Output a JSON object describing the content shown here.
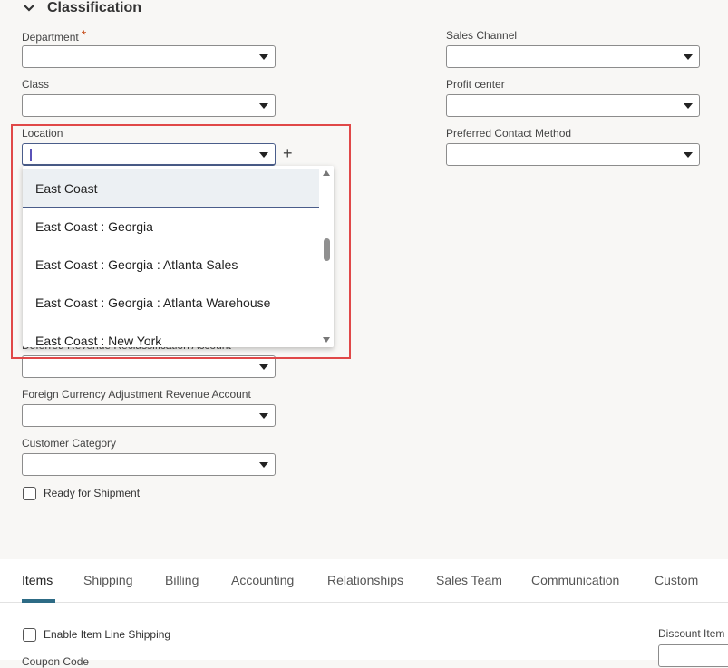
{
  "section": {
    "title": "Classification"
  },
  "left_fields": {
    "department_label": "Department",
    "department_required": "*",
    "class_label": "Class",
    "location_label": "Location",
    "deferred_label": "Deferred Revenue Reclassification Account",
    "foreign_label": "Foreign Currency Adjustment Revenue Account",
    "customer_category_label": "Customer Category",
    "ready_label": "Ready for Shipment"
  },
  "right_fields": {
    "sales_channel_label": "Sales Channel",
    "profit_center_label": "Profit center",
    "preferred_contact_label": "Preferred Contact Method"
  },
  "location_add": "+",
  "dropdown": {
    "options": [
      "East Coast",
      "East Coast : Georgia",
      "East Coast : Georgia : Atlanta Sales",
      "East Coast : Georgia : Atlanta Warehouse",
      "East Coast : New York"
    ]
  },
  "tabs": [
    {
      "label": "Items"
    },
    {
      "label": "Shipping"
    },
    {
      "label": "Billing"
    },
    {
      "label": "Accounting"
    },
    {
      "label": "Relationships"
    },
    {
      "label": "Sales Team"
    },
    {
      "label": "Communication"
    },
    {
      "label": "Custom"
    }
  ],
  "lower": {
    "enable_line_shipping": "Enable Item Line Shipping",
    "discount_item": "Discount Item",
    "coupon_code": "Coupon Code"
  },
  "colors": {
    "accent": "#2d6b85",
    "highlight": "#e04848",
    "required": "#c64c1a"
  }
}
